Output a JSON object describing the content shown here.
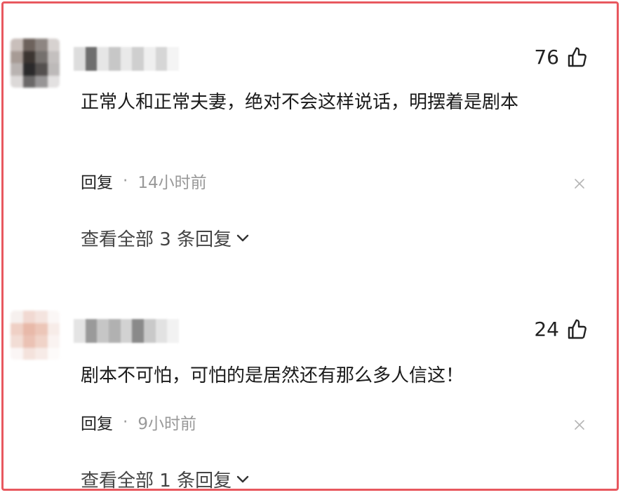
{
  "colors": {
    "frame_border": "#e8585f",
    "text_primary": "#1a1a1a",
    "text_muted": "#999999"
  },
  "comments": [
    {
      "likes": "76",
      "text": "正常人和正常夫妻，绝对不会这样说话，明摆着是剧本",
      "reply_label": "回复",
      "separator": "·",
      "time": "14小时前",
      "view_replies_label": "查看全部 3 条回复",
      "avatar_icon": "blurred-avatar",
      "username_blurred": true
    },
    {
      "likes": "24",
      "text": "剧本不可怕，可怕的是居然还有那么多人信这！",
      "reply_label": "回复",
      "separator": "·",
      "time": "9小时前",
      "view_replies_label": "查看全部 1 条回复",
      "avatar_icon": "blurred-avatar",
      "username_blurred": true
    }
  ]
}
